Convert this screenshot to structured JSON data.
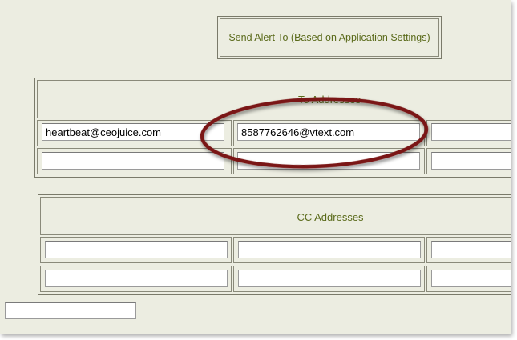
{
  "send_alert": {
    "label": "Send Alert To (Based on Application Settings)"
  },
  "to_addresses": {
    "heading": "To Addresses",
    "rows": [
      [
        "heartbeat@ceojuice.com",
        "8587762646@vtext.com",
        ""
      ],
      [
        "",
        "",
        ""
      ]
    ]
  },
  "cc_addresses": {
    "heading": "CC Addresses",
    "rows": [
      [
        "",
        "",
        ""
      ],
      [
        "",
        "",
        ""
      ]
    ]
  },
  "bottom_field": {
    "value": ""
  },
  "colors": {
    "background": "#ecede1",
    "heading_text": "#5a6a1a",
    "callout_ring": "#7a1515"
  }
}
